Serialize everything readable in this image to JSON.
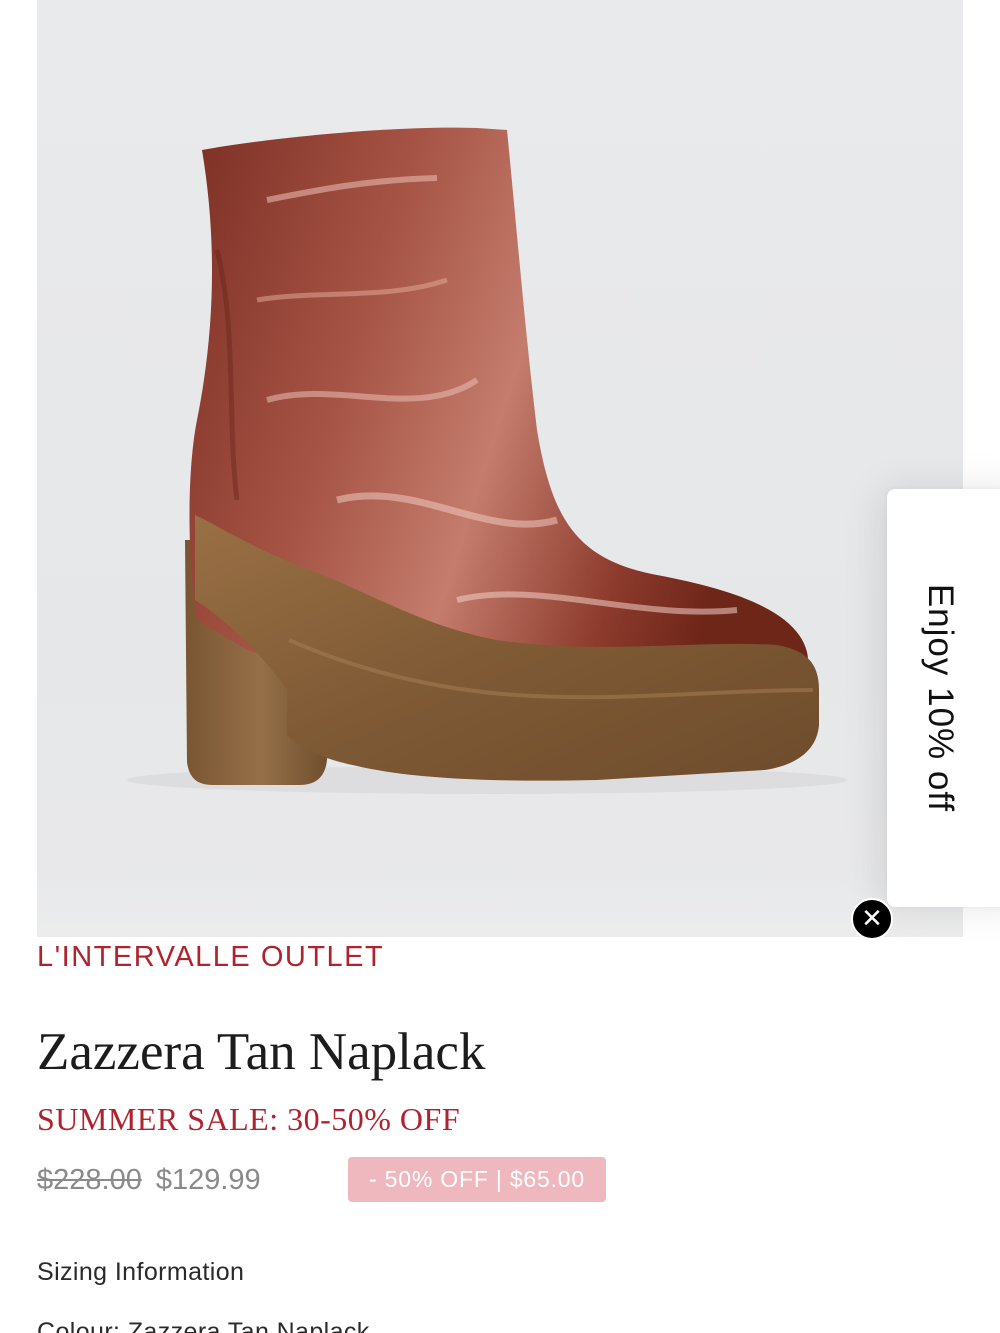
{
  "product": {
    "brand": "L'INTERVALLE OUTLET",
    "title": "Zazzera Tan Naplack",
    "sale_banner": "SUMMER SALE: 30-50% OFF",
    "price_original": "$228.00",
    "price_sale": "$129.99",
    "discount_badge": "- 50% OFF | $65.00",
    "sizing_link": "Sizing Information",
    "colour_line": "Colour: Zazzera Tan Naplack"
  },
  "promo": {
    "tab_text": "Enjoy 10% off",
    "close_icon": "✕"
  },
  "colors": {
    "brand_red": "#b0232e",
    "badge_pink": "#efb8be",
    "boot_leather": "#8a3a2c",
    "boot_sole": "#8a6238"
  },
  "icons": {
    "close": "close-icon",
    "product_image": "boot-image"
  }
}
